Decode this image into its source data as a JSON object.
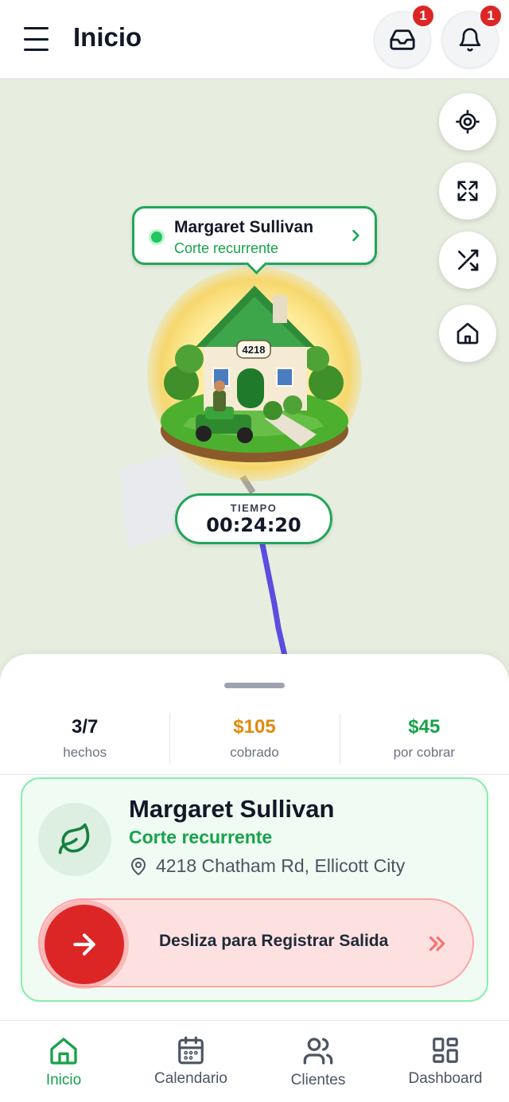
{
  "header": {
    "title": "Inicio",
    "inbox_badge": "1",
    "notifications_badge": "1"
  },
  "map": {
    "callout": {
      "name": "Margaret Sullivan",
      "subtitle": "Corte recurrente"
    },
    "house_number": "4218",
    "timer": {
      "label": "TIEMPO",
      "value": "00:24:20"
    }
  },
  "stats": [
    {
      "value": "3/7",
      "label": "hechos",
      "color": "#111827"
    },
    {
      "value": "$105",
      "label": "cobrado",
      "color": "#e08a0c"
    },
    {
      "value": "$45",
      "label": "por cobrar",
      "color": "#16a34a"
    }
  ],
  "card": {
    "name": "Margaret Sullivan",
    "service": "Corte recurrente",
    "address": "4218 Chatham Rd, Ellicott City",
    "slider_text": "Desliza para Registrar Salida"
  },
  "nav": [
    {
      "label": "Inicio",
      "icon": "home-icon",
      "active": true
    },
    {
      "label": "Calendario",
      "icon": "calendar-icon",
      "active": false
    },
    {
      "label": "Clientes",
      "icon": "users-icon",
      "active": false
    },
    {
      "label": "Dashboard",
      "icon": "dashboard-icon",
      "active": false
    }
  ],
  "colors": {
    "accent": "#16a34a",
    "danger": "#dc2626",
    "map_bg": "#e7eee0"
  }
}
